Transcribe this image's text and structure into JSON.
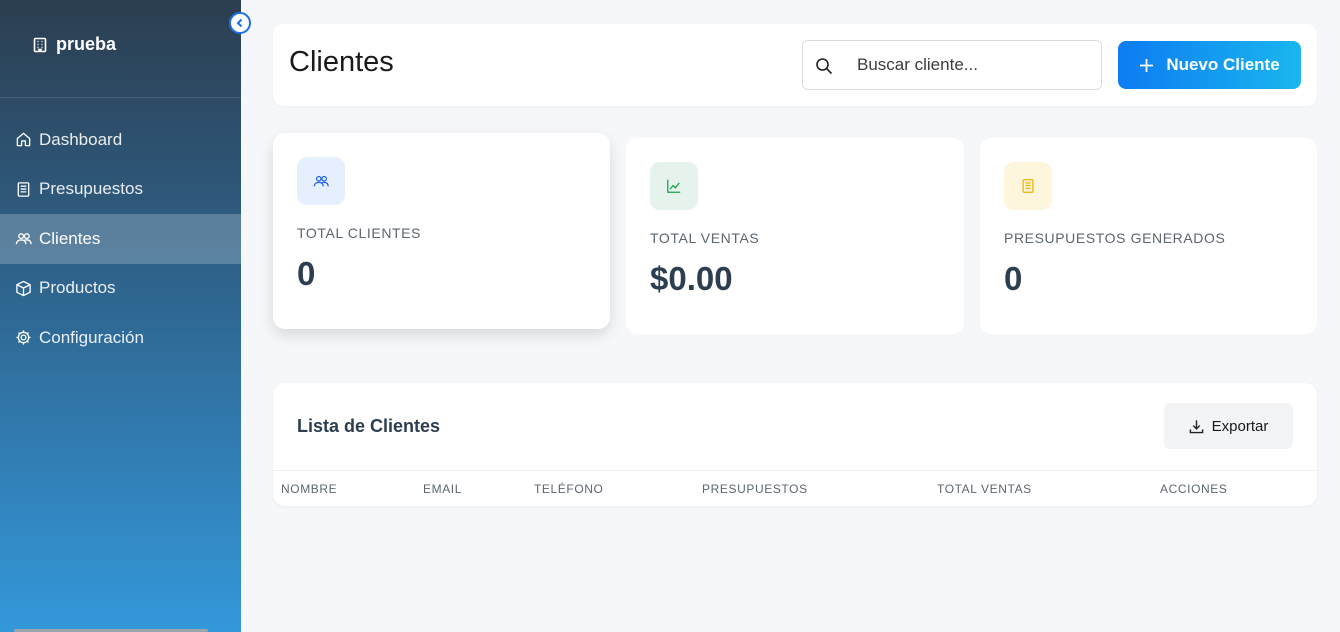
{
  "sidebar": {
    "brand": "prueba",
    "items": [
      {
        "label": "Dashboard",
        "icon": "home-icon"
      },
      {
        "label": "Presupuestos",
        "icon": "document-icon"
      },
      {
        "label": "Clientes",
        "icon": "users-icon",
        "active": true
      },
      {
        "label": "Productos",
        "icon": "box-icon"
      },
      {
        "label": "Configuración",
        "icon": "gear-icon"
      }
    ]
  },
  "header": {
    "title": "Clientes",
    "search_placeholder": "Buscar cliente...",
    "new_button": "Nuevo Cliente"
  },
  "stats": [
    {
      "label": "TOTAL CLIENTES",
      "value": "0",
      "icon": "users-icon",
      "color": "#2563eb"
    },
    {
      "label": "TOTAL VENTAS",
      "value": "$0.00",
      "icon": "chart-line-icon",
      "color": "#16a34a"
    },
    {
      "label": "PRESUPUESTOS GENERADOS",
      "value": "0",
      "icon": "document-icon",
      "color": "#eab308"
    }
  ],
  "list": {
    "title": "Lista de Clientes",
    "export_button": "Exportar",
    "columns": [
      "NOMBRE",
      "EMAIL",
      "TELÉFONO",
      "PRESUPUESTOS",
      "TOTAL VENTAS",
      "ACCIONES"
    ]
  }
}
